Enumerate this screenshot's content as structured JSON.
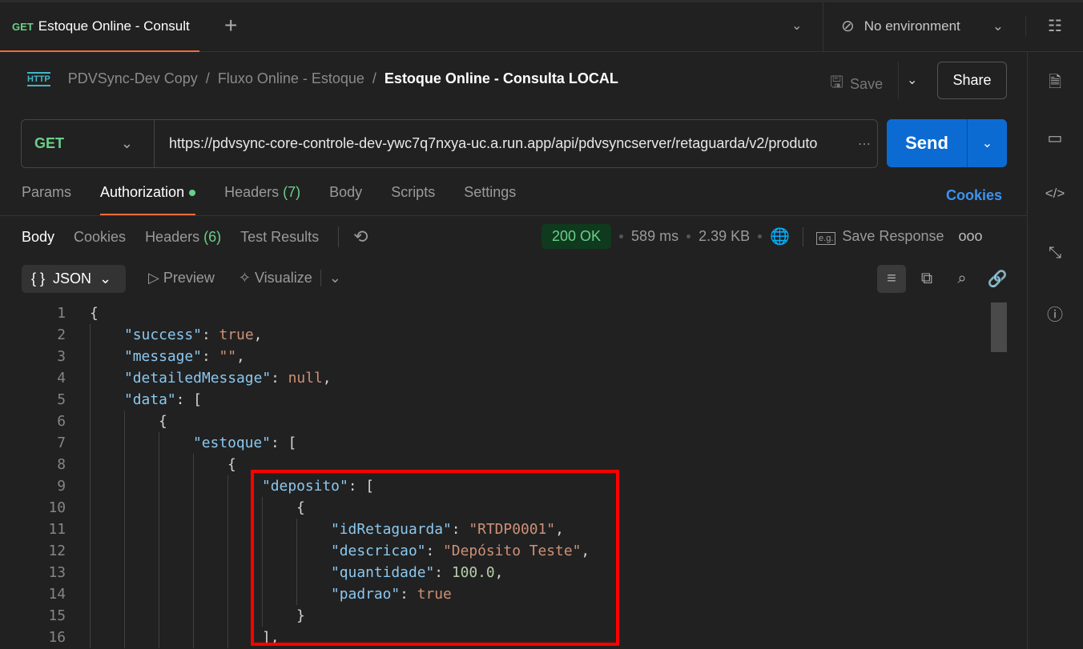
{
  "tab": {
    "method": "GET",
    "title": "Estoque Online - Consult"
  },
  "environment": {
    "label": "No environment"
  },
  "breadcrumb": {
    "icon": "HTTP",
    "items": [
      "PDVSync-Dev Copy",
      "Fluxo Online - Estoque"
    ],
    "current": "Estoque Online - Consulta LOCAL"
  },
  "actions": {
    "save": "Save",
    "share": "Share"
  },
  "request": {
    "method": "GET",
    "url": "https://pdvsync-core-controle-dev-ywc7q7nxya-uc.a.run.app/api/pdvsyncserver/retaguarda/v2/produto",
    "send": "Send"
  },
  "request_tabs": [
    {
      "label": "Params"
    },
    {
      "label": "Authorization",
      "active": true
    },
    {
      "label": "Headers",
      "count": "(7)"
    },
    {
      "label": "Body"
    },
    {
      "label": "Scripts"
    },
    {
      "label": "Settings"
    }
  ],
  "cookies_link": "Cookies",
  "response_tabs": [
    {
      "label": "Body",
      "active": true
    },
    {
      "label": "Cookies"
    },
    {
      "label": "Headers",
      "count": "(6)"
    },
    {
      "label": "Test Results"
    }
  ],
  "status": {
    "code": "200 OK",
    "time": "589 ms",
    "size": "2.39 KB",
    "save_response": "Save Response",
    "status_color": "#6bcf8a"
  },
  "format": {
    "selected": "JSON",
    "preview": "Preview",
    "visualize": "Visualize"
  },
  "code_lines": [
    {
      "n": "1",
      "indent": 0,
      "t": [
        [
          "p",
          "{"
        ]
      ]
    },
    {
      "n": "2",
      "indent": 1,
      "t": [
        [
          "k",
          "\"success\""
        ],
        [
          "p",
          ": "
        ],
        [
          "s",
          "true"
        ],
        [
          "p",
          ","
        ]
      ]
    },
    {
      "n": "3",
      "indent": 1,
      "t": [
        [
          "k",
          "\"message\""
        ],
        [
          "p",
          ": "
        ],
        [
          "s",
          "\"\""
        ],
        [
          "p",
          ","
        ]
      ]
    },
    {
      "n": "4",
      "indent": 1,
      "t": [
        [
          "k",
          "\"detailedMessage\""
        ],
        [
          "p",
          ": "
        ],
        [
          "s",
          "null"
        ],
        [
          "p",
          ","
        ]
      ]
    },
    {
      "n": "5",
      "indent": 1,
      "t": [
        [
          "k",
          "\"data\""
        ],
        [
          "p",
          ": ["
        ]
      ]
    },
    {
      "n": "6",
      "indent": 2,
      "t": [
        [
          "p",
          "{"
        ]
      ]
    },
    {
      "n": "7",
      "indent": 3,
      "t": [
        [
          "k",
          "\"estoque\""
        ],
        [
          "p",
          ": ["
        ]
      ]
    },
    {
      "n": "8",
      "indent": 4,
      "t": [
        [
          "p",
          "{"
        ]
      ]
    },
    {
      "n": "9",
      "indent": 5,
      "t": [
        [
          "k",
          "\"deposito\""
        ],
        [
          "p",
          ": ["
        ]
      ]
    },
    {
      "n": "10",
      "indent": 6,
      "t": [
        [
          "p",
          "{"
        ]
      ]
    },
    {
      "n": "11",
      "indent": 7,
      "t": [
        [
          "k",
          "\"idRetaguarda\""
        ],
        [
          "p",
          ": "
        ],
        [
          "s",
          "\"RTDP0001\""
        ],
        [
          "p",
          ","
        ]
      ]
    },
    {
      "n": "12",
      "indent": 7,
      "t": [
        [
          "k",
          "\"descricao\""
        ],
        [
          "p",
          ": "
        ],
        [
          "s",
          "\"Depósito Teste\""
        ],
        [
          "p",
          ","
        ]
      ]
    },
    {
      "n": "13",
      "indent": 7,
      "t": [
        [
          "k",
          "\"quantidade\""
        ],
        [
          "p",
          ": "
        ],
        [
          "n",
          "100.0"
        ],
        [
          "p",
          ","
        ]
      ]
    },
    {
      "n": "14",
      "indent": 7,
      "t": [
        [
          "k",
          "\"padrao\""
        ],
        [
          "p",
          ": "
        ],
        [
          "s",
          "true"
        ]
      ]
    },
    {
      "n": "15",
      "indent": 6,
      "t": [
        [
          "p",
          "}"
        ]
      ]
    },
    {
      "n": "16",
      "indent": 5,
      "t": [
        [
          "p",
          "],"
        ]
      ]
    }
  ],
  "highlight_color": "#ff0000"
}
